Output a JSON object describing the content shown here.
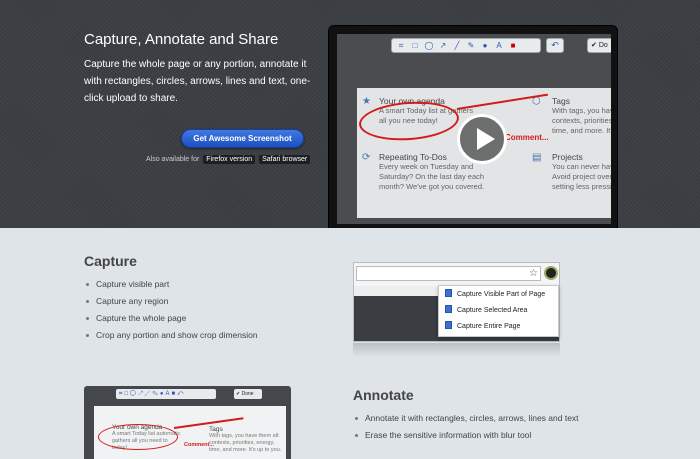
{
  "hero": {
    "title": "Capture, Annotate and Share",
    "description": "Capture the whole page or any portion, annotate it with rectangles, circles, arrows, lines and text, one-click upload to share.",
    "cta_label": "Get Awesome Screenshot",
    "also_label": "Also available for",
    "firefox_label": "Firefox version",
    "safari_label": "Safari browser"
  },
  "preview": {
    "done_label": "Do",
    "items": [
      {
        "title": "Your own agenda",
        "text": "A smart Today list at gathers all you nee today!"
      },
      {
        "title": "Tags",
        "text": "With tags, you have contexts, priorities, time, and more. It's"
      },
      {
        "title": "Repeating To-Dos",
        "text": "Every week on Tuesday and Saturday? On the last day each month? We've got you covered."
      },
      {
        "title": "Projects",
        "text": "You can never have Avoid project overlo setting less pressin"
      }
    ],
    "comment": "Comment..."
  },
  "capture": {
    "title": "Capture",
    "bullets": [
      "Capture visible part",
      "Capture any region",
      "Capture the whole page",
      "Crop any portion and show crop dimension"
    ],
    "menu": [
      "Capture Visible Part of Page",
      "Capture Selected Area",
      "Capture Entire Page"
    ]
  },
  "annotate": {
    "title": "Annotate",
    "bullets": [
      "Annotate it with rectangles, circles, arrows, lines and text",
      "Erase the sensitive information with blur tool"
    ],
    "mini": {
      "done_label": "Done",
      "item1_title": "Your own agenda",
      "item1_text": "A smart Today list automatic gathers all you need to today!",
      "item2_title": "Tags",
      "item2_text": "With tags, you have them all: contexts, priorities, energy, time, and more. It's up to you.",
      "comment": "Comment..."
    }
  },
  "colors": {
    "accent": "#2c57b6",
    "annotation": "#d41a1a",
    "hero_bg": "#3c3f44"
  }
}
